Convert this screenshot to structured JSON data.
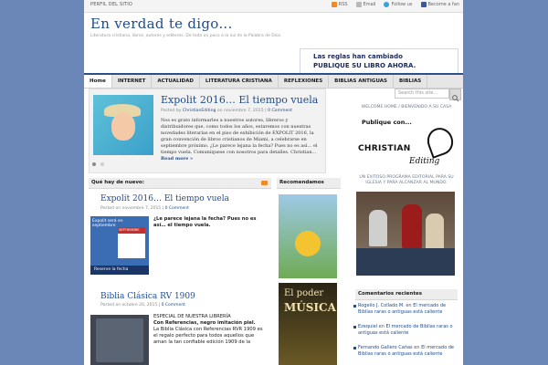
{
  "topbar": {
    "perfil": "PERFIL DEL SITIO",
    "links": [
      "RSS",
      "Email",
      "Follow us",
      "Become a fan"
    ]
  },
  "site": {
    "title": "En verdad te digo...",
    "description": "Literatura cristiana, libros, autores y editores. De todo un poco a la luz de la Palabra de Dios."
  },
  "banner": {
    "line1": "Las reglas han cambiado",
    "line2": "PUBLIQUE SU LIBRO AHORA."
  },
  "nav": {
    "items": [
      "Home",
      "INTERNET",
      "ACTUALIDAD",
      "LITERATURA CRISTIANA",
      "REFLEXIONES",
      "BIBLIAS ANTIGUAS",
      "BIBLIAS"
    ]
  },
  "search": {
    "placeholder": "Search this site..."
  },
  "featured": {
    "title": "Expolit 2016… El tiempo vuela",
    "meta_posted": "Posted by",
    "meta_author": "ChristianEditing",
    "meta_on": "on",
    "meta_date": "noviembre 7, 2015",
    "meta_comment": "0 Comment",
    "body": "Nos es grato informarles a nuestros autores, libreros y distribuidores que, como todos los años, estaremos con nuestras novedades literarias en el piso de exhibición de EXPOLIT 2016, la gran convención de libros cristianos de Miami, a celebrarse en septiembre próximo. ¿Le parece lejana la fecha? Pues no es así… el tiempo vuela. Comuníquese con nosotros para detalles. Christian...",
    "more": "Read more »"
  },
  "whats_new": {
    "heading": "Qué hay de nuevo:",
    "posts": [
      {
        "title": "Expolit 2016… El tiempo vuela",
        "meta_posted": "Posted on",
        "meta_date": "noviembre 7, 2015",
        "meta_comment": "0 Comment",
        "text": "¿Le parece lejana la fecha? Pues no es así… el tiempo vuela."
      },
      {
        "title": "Biblia Clásica RV 1909",
        "meta_posted": "Posted on",
        "meta_date": "octubre 20, 2015",
        "meta_comment": "0 Comment",
        "text_intro": "ESPECIAL DE NUESTRA LIBRERÍA",
        "text_bold": "Con Referencias, negro imitación piel.",
        "text_rest": "La Biblia Clásica con Referencias RVR 1909 es el regalo perfecto para todos aquellos que aman la tan confiable edición 1909 de la"
      }
    ]
  },
  "thumbs": {
    "thumb1_text": "Expolit será en septiembre",
    "thumb1_month": "SEPTIEMBRE",
    "thumb1_bar": "Reserve la fecha"
  },
  "recomendamos": {
    "heading": "Recomendamos",
    "book2_line1": "El poder",
    "book2_line2": "MÚSICA"
  },
  "sidebar": {
    "welcome": "WELCOME HOME / BIENVENIDO A SU CASA",
    "logo_publique": "Publique con...",
    "logo_christian": "CHRISTIAN",
    "logo_editing": "Editing",
    "program": "UN EXITOSO PROGRAMA EDITORIAL PARA SU IGLESIA Y PARA ALCANZAR AL MUNDO.",
    "comments_heading": "Comentarios recientes",
    "comments": [
      {
        "author": "Rogelio J. Collado M.",
        "in": "en",
        "post": "El mercado de Biblias raras o antiguas está caliente"
      },
      {
        "author": "Ezequiel",
        "in": "en",
        "post": "El mercado de Biblias raras o antiguas está caliente"
      },
      {
        "author": "Fernando Gallero Cañas",
        "in": "en",
        "post": "El mercado de Biblias raras o antiguas está caliente"
      }
    ]
  }
}
